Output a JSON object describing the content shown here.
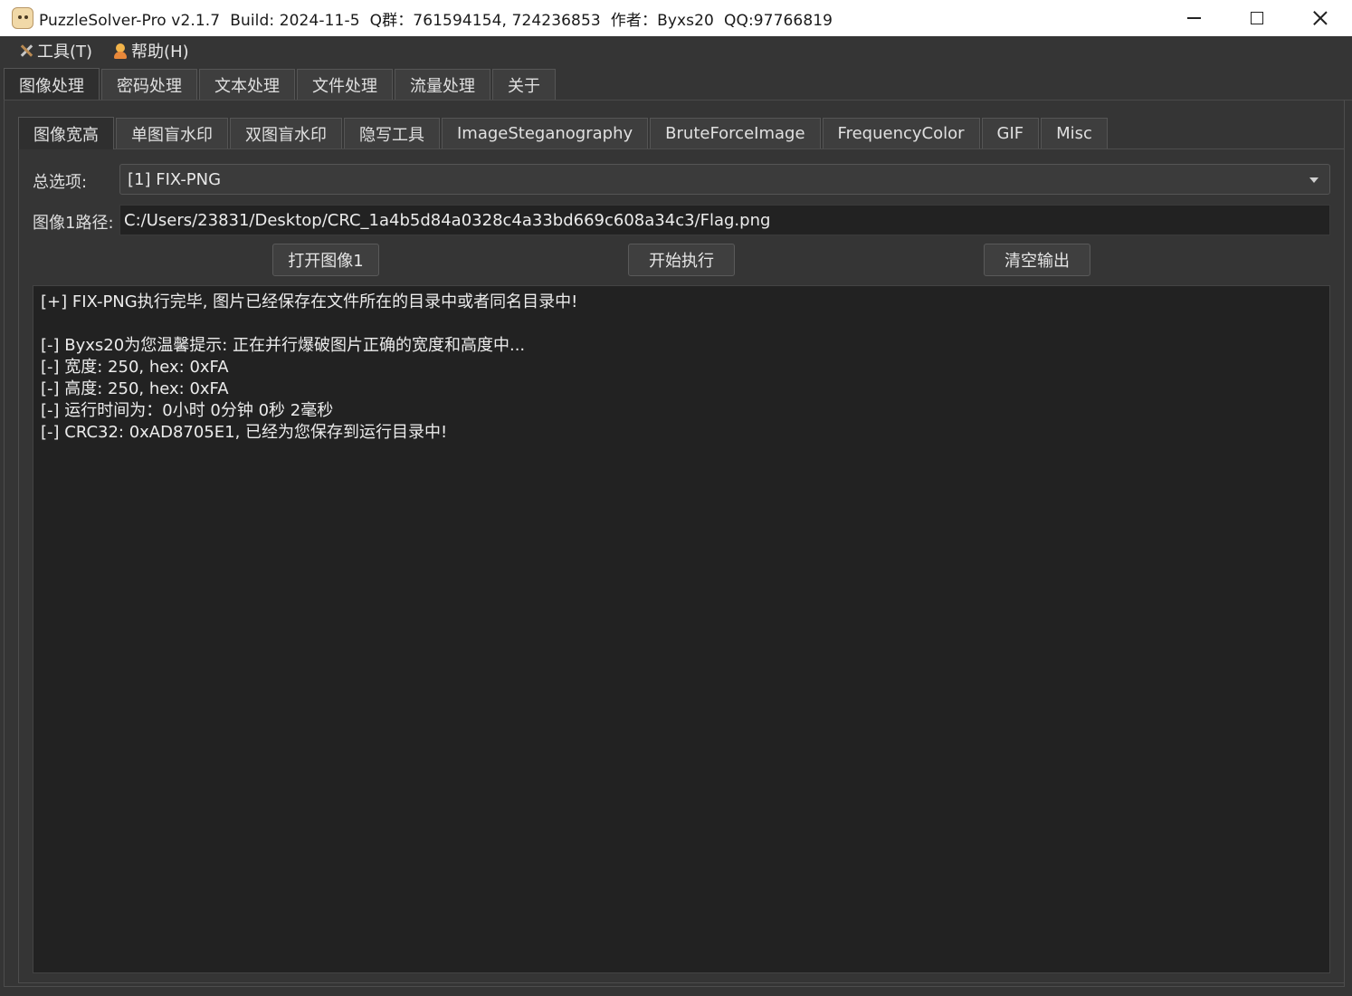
{
  "window": {
    "title": "PuzzleSolver-Pro v2.1.7  Build: 2024-11-5  Q群：761594154, 724236853  作者：Byxs20  QQ:97766819",
    "app_icon": "puzzle-sheep-icon"
  },
  "menu": {
    "items": [
      {
        "label": "工具(T)",
        "icon": "tools-icon"
      },
      {
        "label": "帮助(H)",
        "icon": "help-person-icon"
      }
    ]
  },
  "main_tabs": [
    {
      "label": "图像处理",
      "active": true
    },
    {
      "label": "密码处理",
      "active": false
    },
    {
      "label": "文本处理",
      "active": false
    },
    {
      "label": "文件处理",
      "active": false
    },
    {
      "label": "流量处理",
      "active": false
    },
    {
      "label": "关于",
      "active": false
    }
  ],
  "sub_tabs": [
    {
      "label": "图像宽高",
      "active": true
    },
    {
      "label": "单图盲水印",
      "active": false
    },
    {
      "label": "双图盲水印",
      "active": false
    },
    {
      "label": "隐写工具",
      "active": false
    },
    {
      "label": "ImageSteganography",
      "active": false
    },
    {
      "label": "BruteForceImage",
      "active": false
    },
    {
      "label": "FrequencyColor",
      "active": false
    },
    {
      "label": "GIF",
      "active": false
    },
    {
      "label": "Misc",
      "active": false
    }
  ],
  "form": {
    "option_label": "总选项:",
    "option_value": "[1] FIX-PNG",
    "path_label": "图像1路径:",
    "path_value": "C:/Users/23831/Desktop/CRC_1a4b5d84a0328c4a33bd669c608a34c3/Flag.png"
  },
  "buttons": {
    "open": "打开图像1",
    "run": "开始执行",
    "clear": "清空输出"
  },
  "output_lines": [
    "[+] FIX-PNG执行完毕, 图片已经保存在文件所在的目录中或者同名目录中!",
    "",
    "[-] Byxs20为您温馨提示: 正在并行爆破图片正确的宽度和高度中...",
    "[-] 宽度: 250, hex: 0xFA",
    "[-] 高度: 250, hex: 0xFA",
    "[-] 运行时间为：0小时 0分钟 0秒 2毫秒",
    "[-] CRC32: 0xAD8705E1, 已经为您保存到运行目录中!"
  ]
}
